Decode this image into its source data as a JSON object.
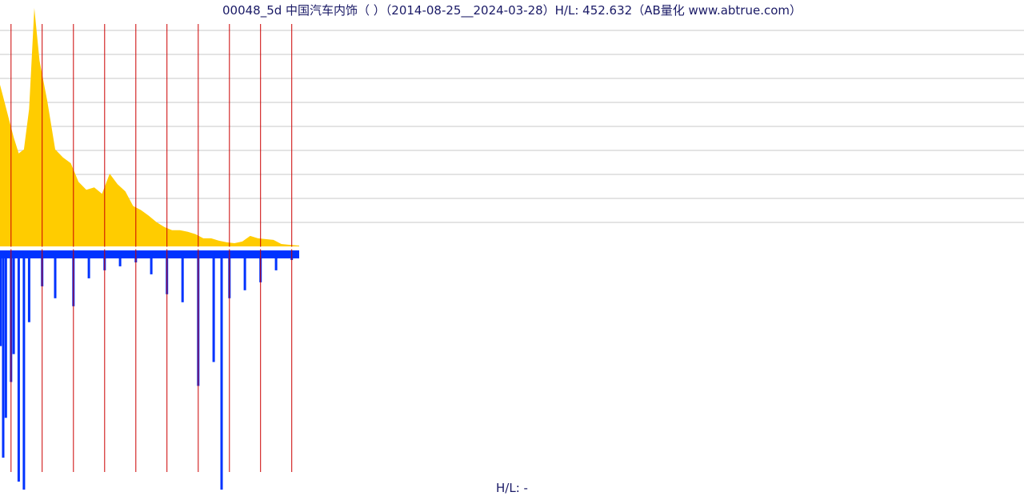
{
  "chart_data": {
    "type": "area",
    "title": "00048_5d 中国汽车内饰（ ）（2014-08-25__2024-03-28）H/L: 452.632（AB量化  www.abtrue.com）",
    "x_range": [
      "2014-08-25",
      "2024-03-28"
    ],
    "hl_ratio": 452.632,
    "footer_text": "H/L: -",
    "grid": true,
    "series": [
      {
        "role": "price",
        "color": "#ffcc00",
        "x": [
          "2014-08-25",
          "2014-10",
          "2014-12",
          "2015-02",
          "2015-04",
          "2015-06",
          "2015-08",
          "2015-10",
          "2015-12",
          "2016-03",
          "2016-06",
          "2016-09",
          "2016-12",
          "2017-03",
          "2017-06",
          "2017-09",
          "2017-12",
          "2018-03",
          "2018-06",
          "2018-09",
          "2018-12",
          "2019-03",
          "2019-06",
          "2019-09",
          "2019-12",
          "2020-03",
          "2020-06",
          "2020-09",
          "2020-12",
          "2021-03",
          "2021-06",
          "2021-09",
          "2021-12",
          "2022-03",
          "2022-06",
          "2022-09",
          "2022-12",
          "2023-03",
          "2023-06",
          "2023-09",
          "2023-12",
          "2024-03-28"
        ],
        "values": [
          200,
          185,
          160,
          135,
          115,
          120,
          170,
          295,
          230,
          180,
          120,
          110,
          103,
          80,
          70,
          73,
          65,
          90,
          77,
          68,
          50,
          45,
          38,
          30,
          24,
          20,
          20,
          18,
          15,
          10,
          10,
          7,
          5,
          4,
          6,
          13,
          10,
          9,
          8,
          3,
          2,
          1
        ]
      },
      {
        "role": "volume",
        "color": "#0033ff",
        "x": [
          "2014-09",
          "2014-10",
          "2014-11",
          "2015-01",
          "2015-02",
          "2015-04",
          "2015-06",
          "2015-08",
          "2016-01",
          "2016-06",
          "2017-01",
          "2017-07",
          "2018-01",
          "2018-07",
          "2019-01",
          "2019-07",
          "2020-01",
          "2020-07",
          "2021-01",
          "2021-07",
          "2021-10",
          "2022-01",
          "2022-07",
          "2023-01",
          "2023-07",
          "2024-01"
        ],
        "values": [
          120,
          260,
          210,
          165,
          130,
          290,
          300,
          90,
          45,
          60,
          70,
          35,
          25,
          20,
          15,
          30,
          55,
          65,
          170,
          140,
          300,
          60,
          50,
          40,
          25,
          12
        ]
      }
    ],
    "markers": [
      "2015",
      "2016",
      "2017",
      "2018",
      "2019",
      "2020",
      "2021",
      "2022",
      "2023",
      "2024"
    ],
    "colors": {
      "price": "#ffcc00",
      "volume": "#0033ff",
      "marker": "#cc0000",
      "grid": "#c8c8c8",
      "text": "#1a1a66"
    }
  }
}
